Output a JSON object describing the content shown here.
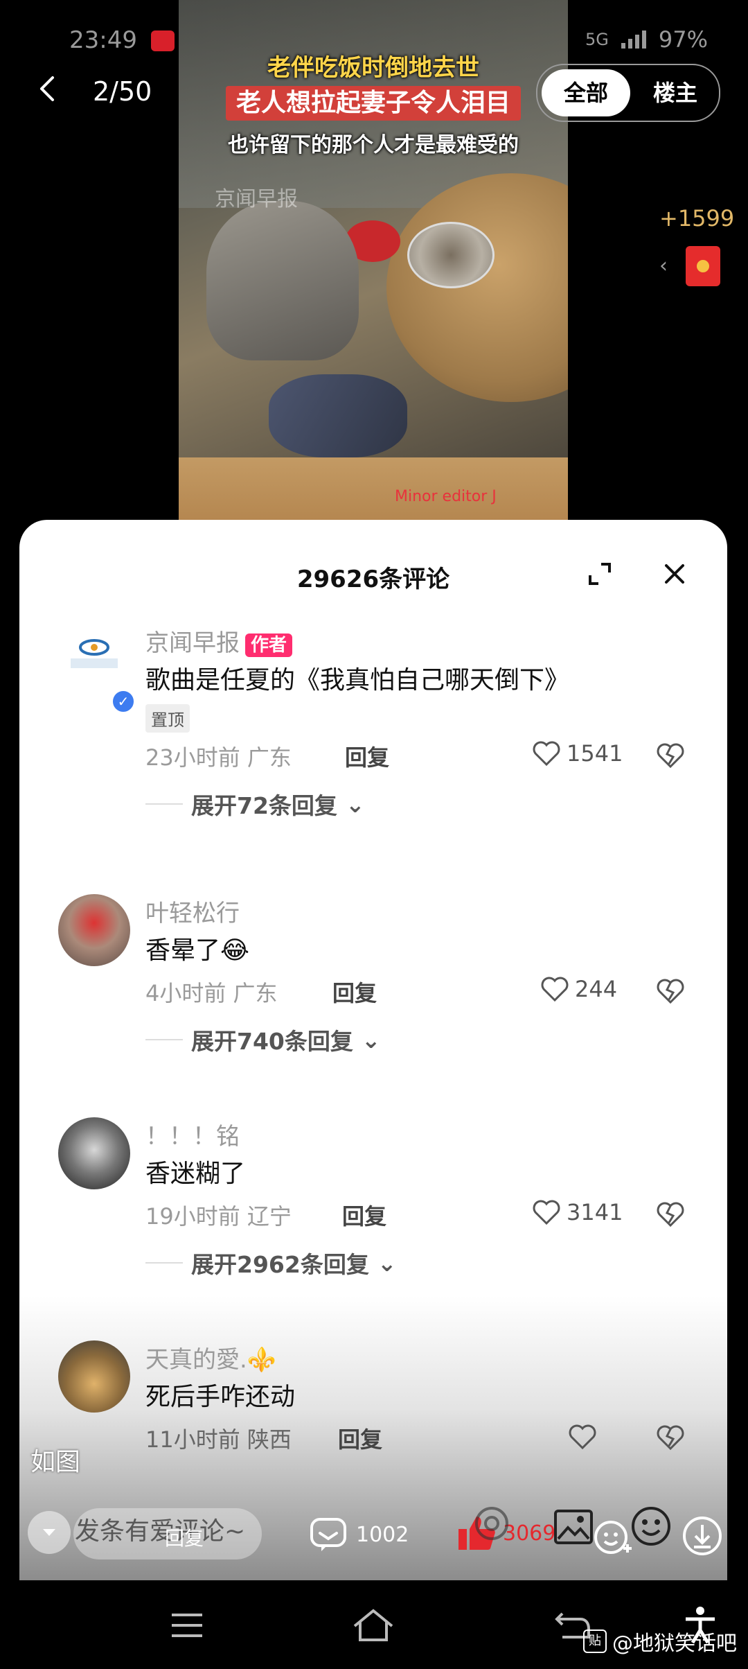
{
  "status": {
    "time": "23:49",
    "network": "5G",
    "battery": "97%"
  },
  "video": {
    "caption_line1": "老伴吃饭时倒地去世",
    "caption_line2": "老人想拉起妻子令人泪目",
    "caption_line3": "也许留下的那个人才是最难受的",
    "watermark": "京闻早报",
    "editor_tag": "Minor editor J"
  },
  "top": {
    "page_counter": "2/50",
    "filter_all": "全部",
    "filter_op": "楼主",
    "bonus": "+1599"
  },
  "comments_panel": {
    "title": "29626条评论",
    "comments": [
      {
        "user": "京闻早报",
        "badge": "作者",
        "text": "歌曲是任夏的《我真怕自己哪天倒下》",
        "pin": "置顶",
        "time": "23小时前",
        "region": "广东",
        "reply": "回复",
        "likes": "1541",
        "expand": "展开72条回复"
      },
      {
        "user": "叶轻松行",
        "text": "香晕了😂",
        "time": "4小时前",
        "region": "广东",
        "reply": "回复",
        "likes": "244",
        "expand": "展开740条回复"
      },
      {
        "user": "！！！铭",
        "text": "香迷糊了",
        "time": "19小时前",
        "region": "辽宁",
        "reply": "回复",
        "likes": "3141",
        "expand": "展开2962条回复"
      },
      {
        "user": "天真的愛.⚜️",
        "text": "死后手咋还动",
        "time": "11小时前",
        "region": "陕西",
        "reply": "回复"
      }
    ]
  },
  "bottom": {
    "overlay_label": "如图",
    "placeholder": "发条有爱评论~",
    "reply_overlay": "回复",
    "comment_count": "1002",
    "like_count": "3069"
  },
  "credit": "@地狱笑话吧",
  "colors": {
    "accent_red": "#e5282e",
    "author_badge": "#ff2d6f",
    "verify_blue": "#3d7cf0"
  }
}
